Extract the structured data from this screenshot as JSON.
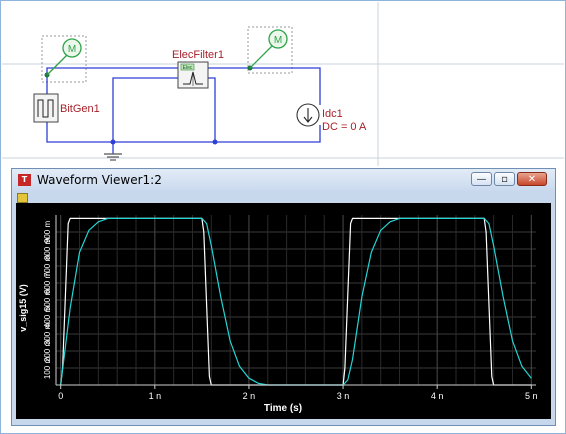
{
  "schematic": {
    "monitor_label": "M",
    "filter_label": "ElecFilter1",
    "filter_tag": "Elec",
    "bitgen_label": "BitGen1",
    "idc_label": "Idc1",
    "idc_value": "DC = 0 A",
    "colors": {
      "wire": "#2d3fd6",
      "label": "#a8202a",
      "monitor": "#2fa34a"
    }
  },
  "window": {
    "title": "Waveform Viewer1:2",
    "app_icon_text": "T",
    "min_glyph": "—",
    "max_glyph": "▫",
    "close_glyph": "✕"
  },
  "chart_data": {
    "type": "line",
    "xlabel": "Time (s)",
    "ylabel": "v_sig15 (V)",
    "xlim": [
      -0.05,
      5.05
    ],
    "ylim": [
      0,
      1.0
    ],
    "x_ticks": [
      "0",
      "1 n",
      "2 n",
      "3 n",
      "4 n",
      "5 n"
    ],
    "y_ticks": [
      "100 m",
      "200 m",
      "300 m",
      "400 m",
      "500 m",
      "600 m",
      "700 m",
      "800 m",
      "900 m"
    ],
    "grid": true,
    "background": "#000000",
    "series": [
      {
        "color": "#ffffff",
        "x": [
          0,
          0.02,
          0.08,
          0.1,
          1.5,
          1.52,
          1.58,
          1.6,
          3.0,
          3.02,
          3.08,
          3.1,
          4.5,
          4.52,
          4.58,
          4.6,
          5.0
        ],
        "y": [
          0,
          0.1,
          0.95,
          0.98,
          0.98,
          0.9,
          0.05,
          0.0,
          0.0,
          0.1,
          0.95,
          0.98,
          0.98,
          0.9,
          0.05,
          0.0,
          0.0
        ]
      },
      {
        "color": "#25d4d4",
        "x": [
          0,
          0.1,
          0.2,
          0.3,
          0.4,
          0.5,
          0.6,
          0.7,
          1.5,
          1.55,
          1.6,
          1.7,
          1.8,
          1.9,
          2.0,
          2.1,
          2.2,
          3.0,
          3.05,
          3.1,
          3.2,
          3.3,
          3.4,
          3.5,
          3.6,
          3.7,
          4.5,
          4.55,
          4.6,
          4.7,
          4.8,
          4.9,
          5.0
        ],
        "y": [
          0,
          0.45,
          0.78,
          0.91,
          0.96,
          0.98,
          0.98,
          0.98,
          0.98,
          0.95,
          0.82,
          0.52,
          0.26,
          0.11,
          0.04,
          0.01,
          0.0,
          0.0,
          0.03,
          0.15,
          0.52,
          0.78,
          0.91,
          0.96,
          0.98,
          0.98,
          0.98,
          0.95,
          0.82,
          0.52,
          0.26,
          0.11,
          0.04
        ]
      }
    ]
  }
}
